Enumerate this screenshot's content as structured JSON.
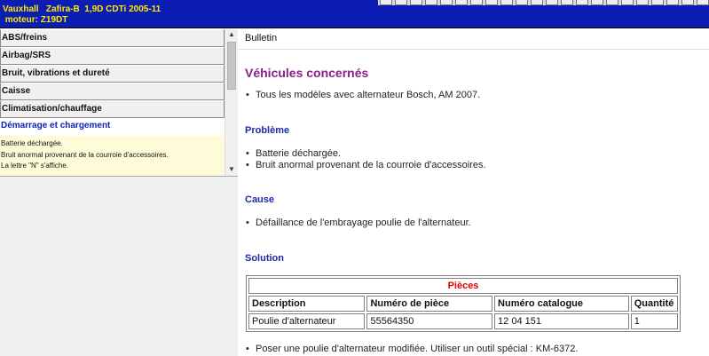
{
  "header": {
    "line1": "Vauxhall   Zafira-B  1,9D CDTi 2005-11",
    "line2": " moteur: Z19DT"
  },
  "sidebar": {
    "categories": [
      {
        "label": "ABS/freins"
      },
      {
        "label": "Airbag/SRS"
      },
      {
        "label": "Bruit, vibrations et dureté"
      },
      {
        "label": "Caisse"
      },
      {
        "label": "Climatisation/chauffage"
      }
    ],
    "active_category": "Démarrage et chargement",
    "sub_items": [
      "Batterie déchargée.",
      "Bruit anormal provenant de la courroie d'accessoires.",
      "La lettre \"N\" s'affiche."
    ]
  },
  "content": {
    "bulletin_label": "Bulletin",
    "vehicules_title": "Véhicules concernés",
    "vehicules_items": [
      "Tous les modèles avec alternateur Bosch, AM 2007."
    ],
    "probleme_title": "Problème",
    "probleme_items": [
      "Batterie déchargée.",
      "Bruit anormal provenant de la courroie d'accessoires."
    ],
    "cause_title": "Cause",
    "cause_items": [
      "Défaillance de l'embrayage poulie de l'alternateur."
    ],
    "solution_title": "Solution",
    "parts_table": {
      "caption": "Pièces",
      "headers": [
        "Description",
        "Numéro de pièce",
        "Numéro catalogue",
        "Quantité"
      ],
      "rows": [
        [
          "Poulie d'alternateur",
          "55564350",
          "12 04 151",
          "1"
        ]
      ]
    },
    "solution_items": [
      "Poser une poulie d'alternateur modifiée. Utiliser un outil spécial : KM-6372."
    ]
  }
}
